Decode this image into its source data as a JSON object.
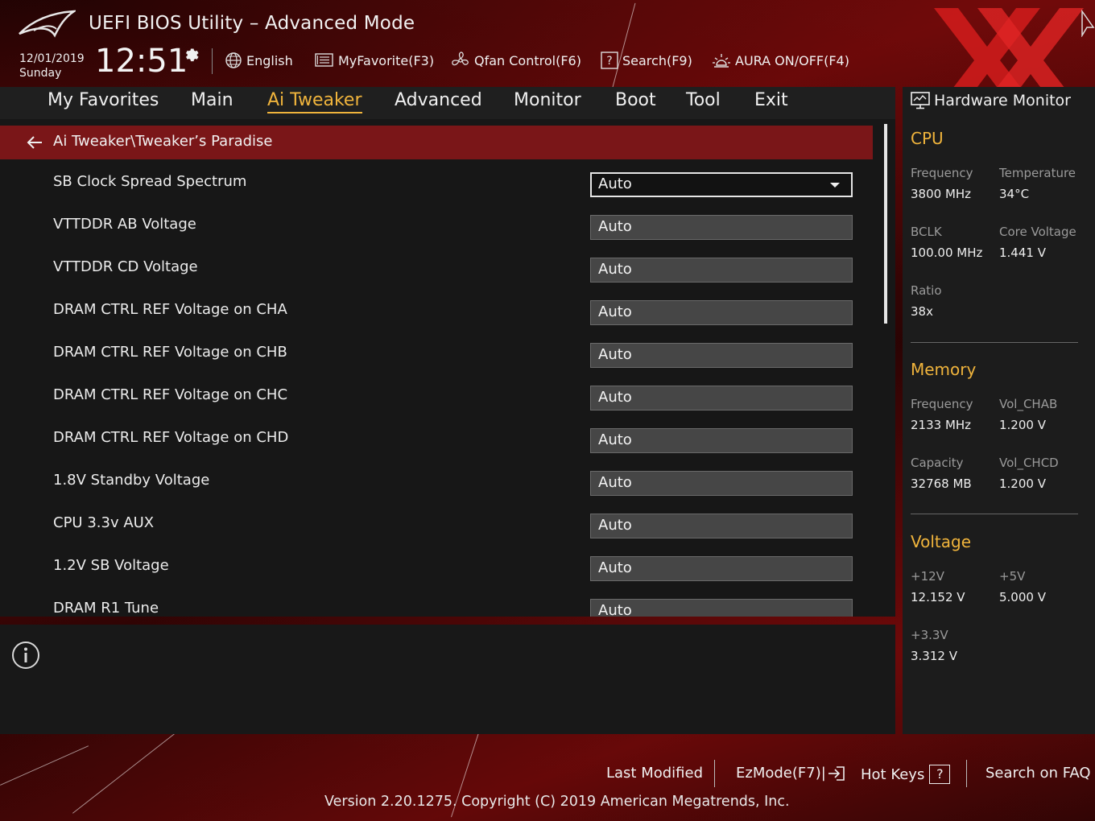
{
  "header": {
    "title": "UEFI BIOS Utility – Advanced Mode",
    "date": "12/01/2019",
    "day": "Sunday",
    "time": "12:51",
    "tools": [
      {
        "label": "English",
        "icon": "globe-icon"
      },
      {
        "label": "MyFavorite(F3)",
        "icon": "favorite-icon"
      },
      {
        "label": "Qfan Control(F6)",
        "icon": "fan-icon"
      },
      {
        "label": "Search(F9)",
        "icon": "search-question-icon"
      },
      {
        "label": "AURA ON/OFF(F4)",
        "icon": "aura-light-icon"
      }
    ]
  },
  "nav": {
    "tabs": [
      "My Favorites",
      "Main",
      "Ai Tweaker",
      "Advanced",
      "Monitor",
      "Boot",
      "Tool",
      "Exit"
    ],
    "active": "Ai Tweaker"
  },
  "breadcrumb": "Ai Tweaker\\Tweaker’s Paradise",
  "settings": [
    {
      "label": "SB Clock Spread Spectrum",
      "value": "Auto"
    },
    {
      "label": "VTTDDR AB Voltage",
      "value": "Auto"
    },
    {
      "label": "VTTDDR CD Voltage",
      "value": "Auto"
    },
    {
      "label": "DRAM CTRL REF Voltage on CHA",
      "value": "Auto"
    },
    {
      "label": "DRAM CTRL REF Voltage on CHB",
      "value": "Auto"
    },
    {
      "label": "DRAM CTRL REF Voltage on CHC",
      "value": "Auto"
    },
    {
      "label": "DRAM CTRL REF Voltage on CHD",
      "value": "Auto"
    },
    {
      "label": "1.8V Standby Voltage",
      "value": "Auto"
    },
    {
      "label": "CPU 3.3v AUX",
      "value": "Auto"
    },
    {
      "label": "1.2V SB Voltage",
      "value": "Auto"
    },
    {
      "label": "DRAM R1 Tune",
      "value": "Auto"
    }
  ],
  "hw_monitor": {
    "title": "Hardware Monitor",
    "cpu": {
      "heading": "CPU",
      "frequency_label": "Frequency",
      "frequency": "3800 MHz",
      "temperature_label": "Temperature",
      "temperature": "34°C",
      "bclk_label": "BCLK",
      "bclk": "100.00 MHz",
      "core_voltage_label": "Core Voltage",
      "core_voltage": "1.441 V",
      "ratio_label": "Ratio",
      "ratio": "38x"
    },
    "memory": {
      "heading": "Memory",
      "frequency_label": "Frequency",
      "frequency": "2133 MHz",
      "vol_chab_label": "Vol_CHAB",
      "vol_chab": "1.200 V",
      "capacity_label": "Capacity",
      "capacity": "32768 MB",
      "vol_chcd_label": "Vol_CHCD",
      "vol_chcd": "1.200 V"
    },
    "voltage": {
      "heading": "Voltage",
      "v12_label": "+12V",
      "v12": "12.152 V",
      "v5_label": "+5V",
      "v5": "5.000 V",
      "v33_label": "+3.3V",
      "v33": "3.312 V"
    }
  },
  "footer": {
    "last_modified": "Last Modified",
    "ezmode": "EzMode(F7)|",
    "hot_keys": "Hot Keys",
    "hot_keys_key": "?",
    "search_faq": "Search on FAQ",
    "version": "Version 2.20.1275. Copyright (C) 2019 American Megatrends, Inc."
  },
  "colors": {
    "accent": "#f0b43c",
    "breadcrumb_bg": "#7a1618",
    "panel_bg": "#171717"
  }
}
